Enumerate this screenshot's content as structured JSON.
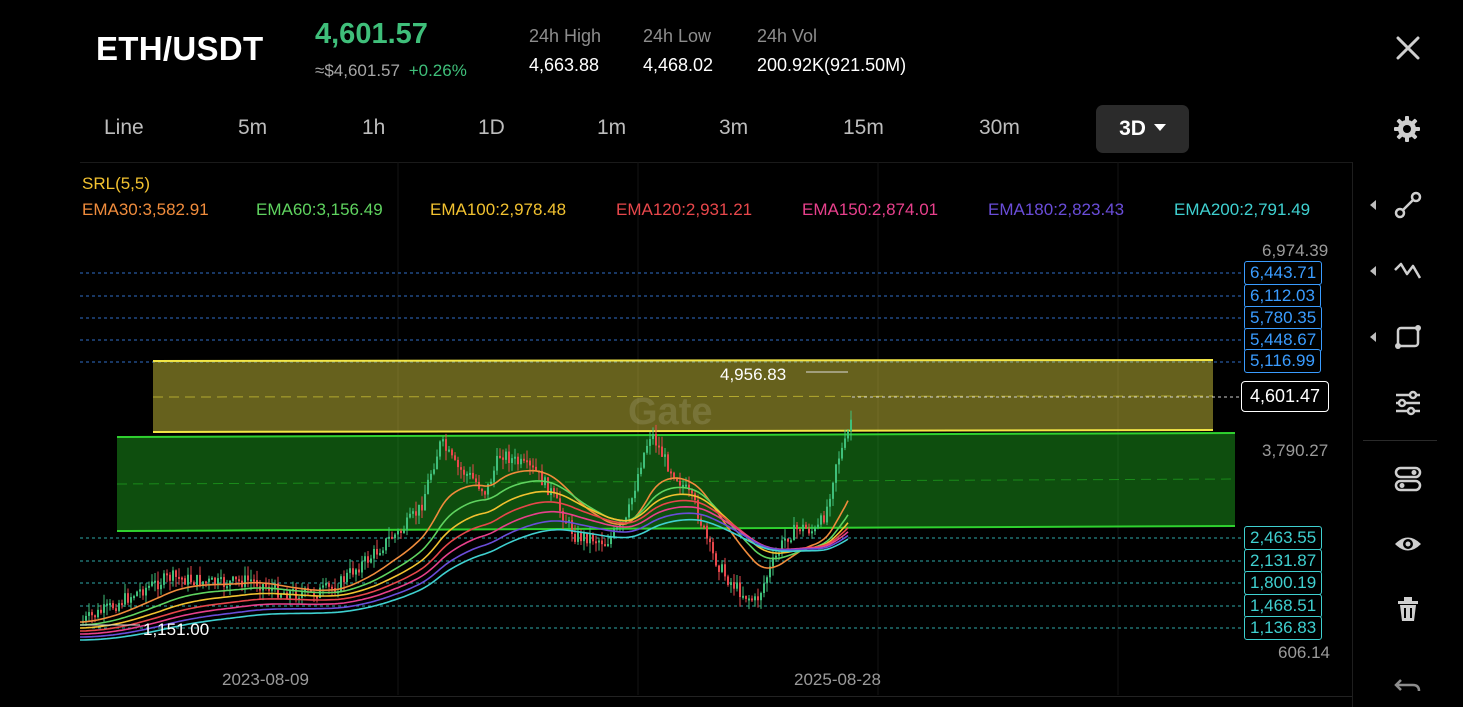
{
  "header": {
    "pair": "ETH/USDT",
    "price": "4,601.57",
    "fiat_price": "≈$4,601.57",
    "change": "+0.26%",
    "stats": [
      {
        "label": "24h High",
        "value": "4,663.88"
      },
      {
        "label": "24h Low",
        "value": "4,468.02"
      },
      {
        "label": "24h Vol",
        "value": "200.92K(921.50M)"
      }
    ]
  },
  "timeframes": [
    "Line",
    "5m",
    "1h",
    "1D",
    "1m",
    "3m",
    "15m",
    "30m"
  ],
  "active_timeframe": "3D",
  "icons": {
    "close": "close-icon",
    "settings": "gear-icon",
    "tools": [
      "trendline-icon",
      "wave-icon",
      "rectangle-icon",
      "sliders-icon",
      "toggle-icon",
      "eye-icon",
      "trash-icon",
      "undo-icon"
    ]
  },
  "indicators": {
    "srl": "SRL(5,5)",
    "emas": [
      {
        "label": "EMA30:3,582.91",
        "color": "#f08c3c"
      },
      {
        "label": "EMA60:3,156.49",
        "color": "#5fd35f"
      },
      {
        "label": "EMA100:2,978.48",
        "color": "#f2c230"
      },
      {
        "label": "EMA120:2,931.21",
        "color": "#e8474b"
      },
      {
        "label": "EMA150:2,874.01",
        "color": "#e8408c"
      },
      {
        "label": "EMA180:2,823.43",
        "color": "#6a4dd9"
      },
      {
        "label": "EMA200:2,791.49",
        "color": "#3fd0d0"
      }
    ]
  },
  "axis": {
    "top": "6,974.39",
    "mid": "3,790.27",
    "bottom": "606.14",
    "resistance_tags": [
      "6,443.71",
      "6,112.03",
      "5,780.35",
      "5,448.67",
      "5,116.99"
    ],
    "support_tags": [
      "2,463.55",
      "2,131.87",
      "1,800.19",
      "1,468.51",
      "1,136.83"
    ],
    "last_price": "4,601.47"
  },
  "annotations": {
    "high": "4,956.83",
    "low": "1,151.00",
    "watermark": "Gate"
  },
  "dates": [
    "2023-08-09",
    "2025-08-28"
  ],
  "colors": {
    "up": "#3fbf7a",
    "down": "#e8474b",
    "yellow_zone": "#f2e646",
    "green_zone": "#2fd12f"
  }
}
